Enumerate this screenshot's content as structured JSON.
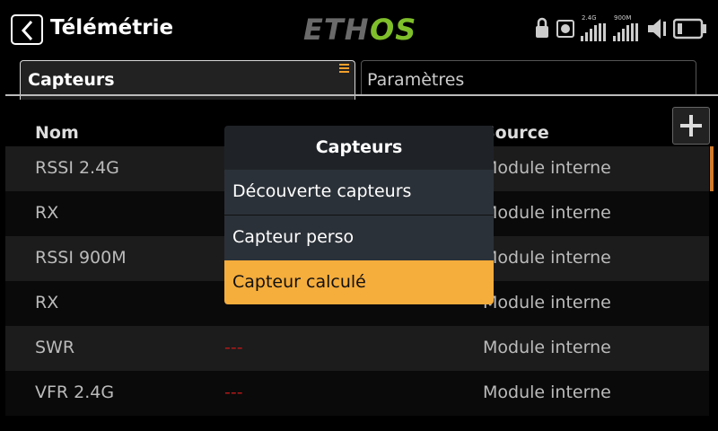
{
  "header": {
    "title": "Télémétrie",
    "logo_text": "ETHOS",
    "rssi_24_label": "2.4G",
    "rssi_900_label": "900M"
  },
  "tabs": [
    {
      "label": "Capteurs",
      "active": true
    },
    {
      "label": "Paramètres",
      "active": false
    }
  ],
  "table": {
    "columns": [
      "Nom",
      "Source"
    ],
    "rows": [
      {
        "name": "RSSI 2.4G",
        "value": "",
        "source": "Module interne"
      },
      {
        "name": "RX",
        "value": "",
        "source": "Module interne"
      },
      {
        "name": "RSSI 900M",
        "value": "",
        "source": "Module interne"
      },
      {
        "name": "RX",
        "value": "---",
        "source": "Module interne"
      },
      {
        "name": "SWR",
        "value": "---",
        "source": "Module interne"
      },
      {
        "name": "VFR 2.4G",
        "value": "---",
        "source": "Module interne"
      }
    ]
  },
  "popup": {
    "title": "Capteurs",
    "items": [
      "Découverte capteurs",
      "Capteur perso",
      "Capteur calculé"
    ],
    "selected_index": 2
  },
  "colors": {
    "accent": "#f5ad3c",
    "logo_green": "#7fbf2a",
    "invalid_value": "#b01818"
  }
}
